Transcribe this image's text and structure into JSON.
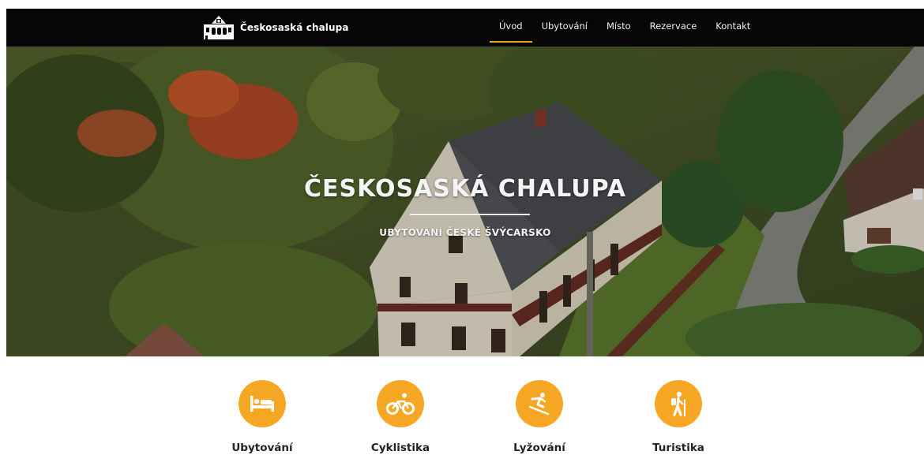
{
  "brand": {
    "name": "Českosaská chalupa"
  },
  "nav": {
    "items": [
      {
        "label": "Úvod",
        "active": true
      },
      {
        "label": "Ubytování",
        "active": false
      },
      {
        "label": "Místo",
        "active": false
      },
      {
        "label": "Rezervace",
        "active": false
      },
      {
        "label": "Kontakt",
        "active": false
      }
    ]
  },
  "hero": {
    "title": "ČESKOSASKÁ CHALUPA",
    "subtitle": "UBYTOVÁNÍ ČESKÉ ŠVÝCARSKO"
  },
  "features": [
    {
      "label": "Ubytování",
      "icon": "bed-icon"
    },
    {
      "label": "Cyklistika",
      "icon": "bicycle-icon"
    },
    {
      "label": "Lyžování",
      "icon": "skiing-icon"
    },
    {
      "label": "Turistika",
      "icon": "hiking-icon"
    }
  ],
  "colors": {
    "accent": "#f5a623",
    "header_bg": "#060606",
    "text_dark": "#222222"
  }
}
